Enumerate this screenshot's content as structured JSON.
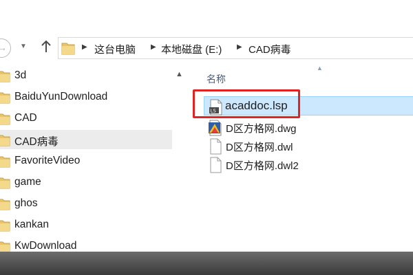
{
  "address_bar": {
    "breadcrumbs": [
      "这台电脑",
      "本地磁盘 (E:)",
      "CAD病毒"
    ]
  },
  "nav_pane": {
    "items": [
      {
        "label": "3d",
        "selected": false
      },
      {
        "label": "BaiduYunDownload",
        "selected": false
      },
      {
        "label": "CAD",
        "selected": false
      },
      {
        "label": "CAD病毒",
        "selected": true
      },
      {
        "label": "FavoriteVideo",
        "selected": false
      },
      {
        "label": "game",
        "selected": false
      },
      {
        "label": "ghos",
        "selected": false
      },
      {
        "label": "kankan",
        "selected": false
      },
      {
        "label": "KwDownload",
        "selected": false
      }
    ]
  },
  "file_list": {
    "column_name": "名称",
    "files": [
      {
        "name": "acaddoc.lsp",
        "icon": "lsp-file-icon",
        "selected": true
      },
      {
        "name": "D区方格网.dwg",
        "icon": "dwg-file-icon",
        "selected": false
      },
      {
        "name": "D区方格网.dwl",
        "icon": "blank-file-icon",
        "selected": false
      },
      {
        "name": "D区方格网.dwl2",
        "icon": "blank-file-icon",
        "selected": false
      }
    ]
  },
  "colors": {
    "highlight_box": "#e02424",
    "selection_fill": "#cce8ff",
    "folder_yellow": "#e8c46a"
  }
}
